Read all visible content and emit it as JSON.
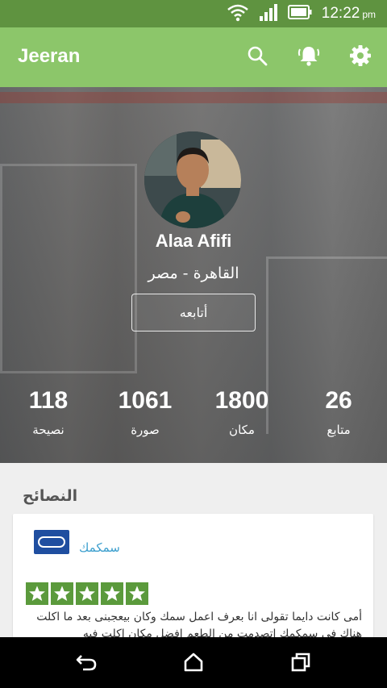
{
  "status_bar": {
    "time": "12:22",
    "time_suffix": "pm",
    "icons": [
      "wifi-icon",
      "signal-icon",
      "battery-icon"
    ]
  },
  "app_bar": {
    "title": "Jeeran",
    "actions": [
      "search-icon",
      "bell-icon",
      "gear-icon"
    ]
  },
  "profile": {
    "name": "Alaa Afifi",
    "location": "القاهرة - مصر",
    "follow_label": "أتابعه"
  },
  "stats": [
    {
      "value": "26",
      "label": "متابع"
    },
    {
      "value": "1800",
      "label": "مكان"
    },
    {
      "value": "1061",
      "label": "صورة"
    },
    {
      "value": "118",
      "label": "نصيحة"
    }
  ],
  "tips": {
    "section_title": "النصائح",
    "items": [
      {
        "place": "سمكمك",
        "rating": 5,
        "text": "أمى كانت دايما تقولى انا بعرف اعمل سمك وكان بيعجبنى بعد ما اكلت هناك في سمكمك اتصدمت من الطعم افضل مكان اكلت فيه"
      }
    ]
  },
  "nav": [
    "back-icon",
    "home-icon",
    "recents-icon"
  ],
  "colors": {
    "status_bar": "#5f9340",
    "app_bar": "#8cc66a",
    "star": "#5b9a3c",
    "link": "#3c9fce"
  }
}
